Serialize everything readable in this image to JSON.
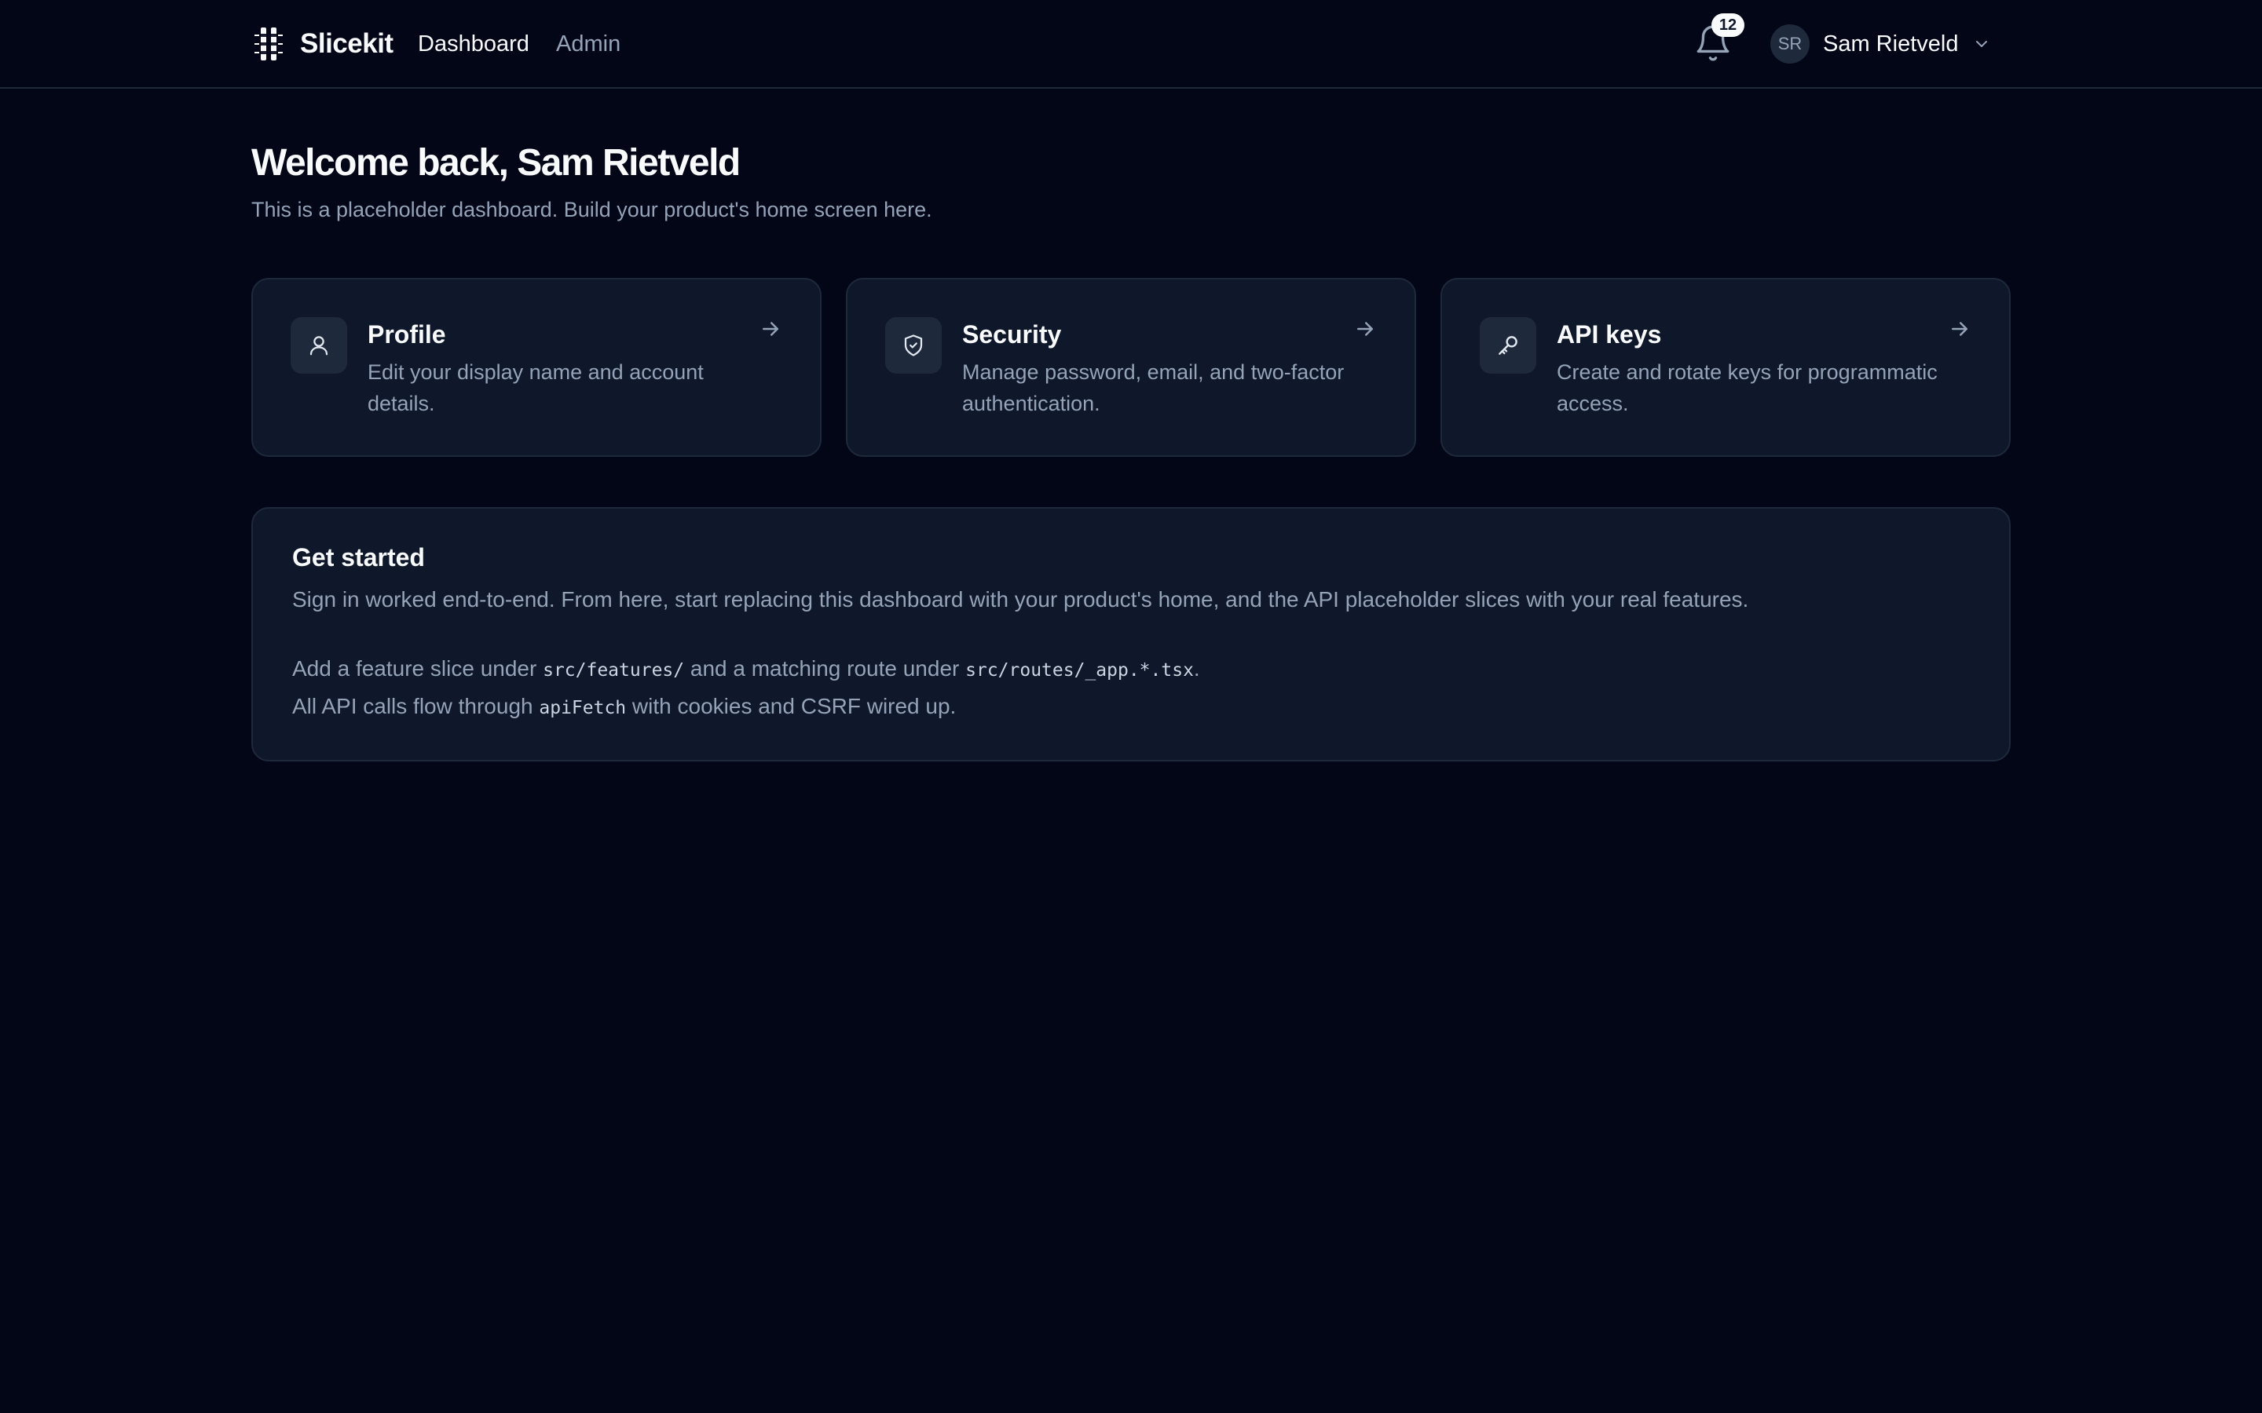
{
  "header": {
    "brand": "Slicekit",
    "nav": [
      {
        "label": "Dashboard",
        "active": true
      },
      {
        "label": "Admin",
        "active": false
      }
    ],
    "notifications_count": "12",
    "user": {
      "initials": "SR",
      "name": "Sam Rietveld"
    }
  },
  "main": {
    "welcome": "Welcome back, Sam Rietveld",
    "subtitle": "This is a placeholder dashboard. Build your product's home screen here.",
    "cards": [
      {
        "icon": "user-icon",
        "title": "Profile",
        "description": "Edit your display name and account details."
      },
      {
        "icon": "shield-check-icon",
        "title": "Security",
        "description": "Manage password, email, and two-factor authentication."
      },
      {
        "icon": "key-icon",
        "title": "API keys",
        "description": "Create and rotate keys for programmatic access."
      }
    ],
    "get_started": {
      "title": "Get started",
      "intro": "Sign in worked end-to-end. From here, start replacing this dashboard with your product's home, and the API placeholder slices with your real features.",
      "line1_a": "Add a feature slice under ",
      "line1_code1": "src/features/",
      "line1_b": " and a matching route under ",
      "line1_code2": "src/routes/_app.*.tsx",
      "line1_c": ".",
      "line2_a": "All API calls flow through ",
      "line2_code": "apiFetch",
      "line2_b": " with cookies and CSRF wired up."
    }
  },
  "colors": {
    "background": "#020617",
    "card": "#0f172a",
    "border": "#1e293b",
    "text": "#f8fafc",
    "muted": "#94a3b8"
  }
}
